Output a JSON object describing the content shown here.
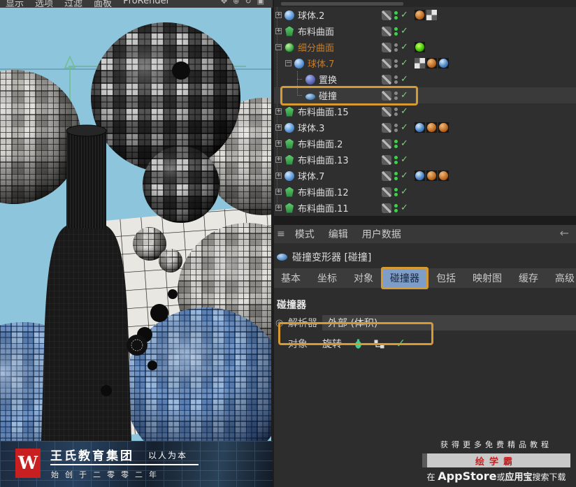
{
  "viewport": {
    "menu_items": [
      "显示",
      "选项",
      "过滤",
      "面板",
      "ProRender"
    ],
    "toolbar_icons": [
      "✥",
      "⊕",
      "↻",
      "▣"
    ],
    "watermark": {
      "logo_letter": "W",
      "brand": "王氏教育集团",
      "slogan": "以人为本",
      "subtitle": "始创于二零零二年"
    }
  },
  "object_manager": {
    "rows": [
      {
        "label": "球体.2",
        "icon": "sphere-icon",
        "indent": 0,
        "expander": "plus",
        "connector": null,
        "dots": "green",
        "check": true,
        "orange_text": false,
        "selected": false,
        "materials": [
          "orange",
          "checker"
        ]
      },
      {
        "label": "布料曲面",
        "icon": "cloth-icon",
        "indent": 0,
        "expander": "plus",
        "connector": null,
        "dots": "green",
        "check": true,
        "orange_text": false,
        "selected": false,
        "materials": []
      },
      {
        "label": "细分曲面",
        "icon": "subdiv-icon",
        "indent": 0,
        "expander": "minus",
        "connector": null,
        "dots": "gray",
        "check": true,
        "orange_text": true,
        "selected": false,
        "materials": [
          "green"
        ]
      },
      {
        "label": "球体.7",
        "icon": "sphere-icon",
        "indent": 1,
        "expander": "minus",
        "connector": null,
        "dots": "gray",
        "check": true,
        "orange_text": true,
        "selected": false,
        "materials": [
          "checker",
          "orange",
          "earth"
        ]
      },
      {
        "label": "置换",
        "icon": "displace-icon",
        "indent": 2,
        "expander": null,
        "connector": "mid",
        "dots": "gray",
        "check": true,
        "orange_text": false,
        "selected": false,
        "materials": []
      },
      {
        "label": "碰撞",
        "icon": "collision-icon",
        "indent": 2,
        "expander": null,
        "connector": "end",
        "dots": "gray",
        "check": true,
        "orange_text": false,
        "selected": true,
        "materials": []
      },
      {
        "label": "布料曲面.15",
        "icon": "cloth-icon",
        "indent": 0,
        "expander": "plus",
        "connector": null,
        "dots": "gray",
        "check": true,
        "orange_text": false,
        "selected": false,
        "materials": []
      },
      {
        "label": "球体.3",
        "icon": "sphere-icon",
        "indent": 0,
        "expander": "plus",
        "connector": null,
        "dots": "gray",
        "check": true,
        "orange_text": false,
        "selected": false,
        "materials": [
          "earth",
          "orange",
          "orange"
        ]
      },
      {
        "label": "布料曲面.2",
        "icon": "cloth-icon",
        "indent": 0,
        "expander": "plus",
        "connector": null,
        "dots": "green",
        "check": true,
        "orange_text": false,
        "selected": false,
        "materials": []
      },
      {
        "label": "布料曲面.13",
        "icon": "cloth-icon",
        "indent": 0,
        "expander": "plus",
        "connector": null,
        "dots": "green",
        "check": true,
        "orange_text": false,
        "selected": false,
        "materials": []
      },
      {
        "label": "球体.7",
        "icon": "sphere-icon",
        "indent": 0,
        "expander": "plus",
        "connector": null,
        "dots": "green",
        "check": true,
        "orange_text": false,
        "selected": false,
        "materials": [
          "earth",
          "orange",
          "orange"
        ]
      },
      {
        "label": "布料曲面.12",
        "icon": "cloth-icon",
        "indent": 0,
        "expander": "plus",
        "connector": null,
        "dots": "green",
        "check": true,
        "orange_text": false,
        "selected": false,
        "materials": []
      },
      {
        "label": "布料曲面.11",
        "icon": "cloth-icon",
        "indent": 0,
        "expander": "plus",
        "connector": null,
        "dots": "green",
        "check": true,
        "orange_text": false,
        "selected": false,
        "materials": []
      }
    ],
    "check_glyph": "✓",
    "plus_glyph": "+",
    "minus_glyph": "−"
  },
  "attribute_manager": {
    "burger_glyph": "≡",
    "menu_items": [
      "模式",
      "编辑",
      "用户数据"
    ],
    "back_arrow": "←",
    "object_title": "碰撞变形器 [碰撞]",
    "tabs": [
      "基本",
      "坐标",
      "对象",
      "碰撞器",
      "包括",
      "映射图",
      "缓存",
      "高级"
    ],
    "active_tab_index": 3,
    "section_title": "碰撞器",
    "radio_glyph": "◎",
    "solver_label": "解析器",
    "solver_value": "外部 (体积)",
    "object_label": "对象",
    "object_value": "旋转",
    "object_check_glyph": "✓"
  },
  "promo": {
    "line1": "获得更多免费精品教程",
    "badge": "绘学霸",
    "line2_prefix": "在",
    "line2_store": "AppStore",
    "line2_mid": "或",
    "line2_app": "应用宝",
    "line2_suffix": "搜索下载"
  },
  "colors": {
    "highlight_orange": "#d79a2f",
    "active_tab_blue": "#7e9ec7",
    "viewport_sky": "#8cc5dc",
    "enabled_green": "#3ed14b",
    "check_green": "#7dd07d",
    "orange_label_text": "#c87c28",
    "logo_red": "#c82020",
    "badge_text_red": "#c22222"
  }
}
